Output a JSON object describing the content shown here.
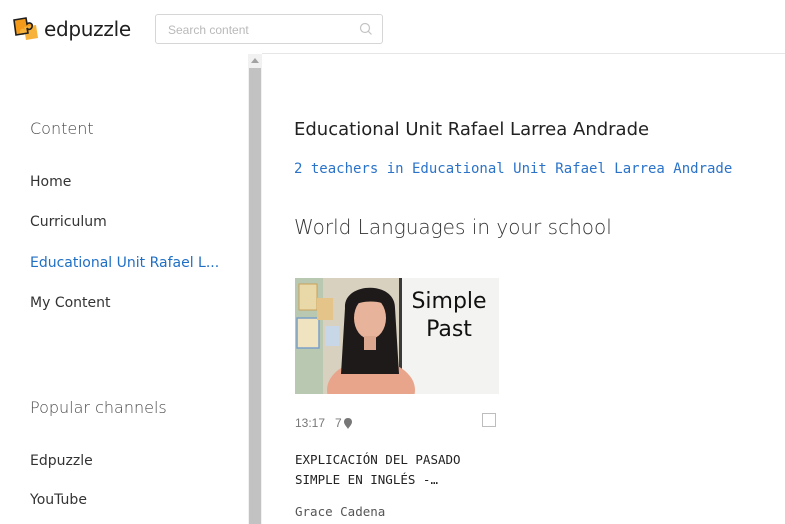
{
  "app": {
    "logo_text": "edpuzzle"
  },
  "search": {
    "placeholder": "Search content"
  },
  "sidebar": {
    "content_heading": "Content",
    "items": [
      {
        "label": "Home",
        "active": false
      },
      {
        "label": "Curriculum",
        "active": false
      },
      {
        "label": "Educational Unit Rafael L...",
        "active": true
      },
      {
        "label": "My Content",
        "active": false
      }
    ],
    "channels_heading": "Popular channels",
    "channels": [
      {
        "label": "Edpuzzle"
      },
      {
        "label": "YouTube"
      }
    ]
  },
  "main": {
    "school_title": "Educational Unit Rafael Larrea Andrade",
    "teachers_link": "2 teachers in Educational Unit Rafael Larrea Andrade",
    "section_title": "World Languages in your school",
    "video": {
      "thumb_text_line1": "Simple",
      "thumb_text_line2": "Past",
      "duration": "13:17",
      "questions": "7",
      "title_line1": "EXPLICACIÓN DEL PASADO",
      "title_line2": "SIMPLE EN INGLÉS -…",
      "author": "Grace Cadena"
    }
  },
  "colors": {
    "accent": "#2a73c9",
    "logo_orange": "#f49a1a"
  }
}
